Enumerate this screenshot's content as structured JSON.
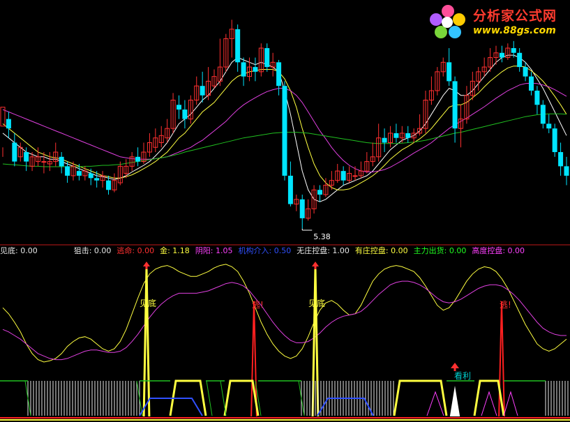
{
  "logo": {
    "title": "分析家公式网",
    "url": "www.88gs.com"
  },
  "legend": [
    {
      "label": "见底:",
      "value": "0.00",
      "color": "#e6e6e6"
    },
    {
      "label": "狙击:",
      "value": "0.00",
      "color": "#e6e6e6"
    },
    {
      "label": "逃命:",
      "value": "0.00",
      "color": "#ff3030"
    },
    {
      "label": "金:",
      "value": "1.18",
      "color": "#ffff40"
    },
    {
      "label": "阴阳:",
      "value": "1.05",
      "color": "#ff40ff"
    },
    {
      "label": "机构介入:",
      "value": "0.50",
      "color": "#3050ff"
    },
    {
      "label": "无庄控盘:",
      "value": "1.00",
      "color": "#e6e6e6"
    },
    {
      "label": "有庄控盘:",
      "value": "0.00",
      "color": "#ffff40"
    },
    {
      "label": "主力出货:",
      "value": "0.00",
      "color": "#20ff20"
    },
    {
      "label": "高度控盘:",
      "value": "0.00",
      "color": "#ff40ff"
    }
  ],
  "chart_data": [
    {
      "type": "candlestick",
      "price_label": "5.38",
      "colors": {
        "up": "#ff3030",
        "down": "#00e5ff",
        "ma_white": "#ffffff",
        "ma_yellow": "#ffff40",
        "ma_magenta": "#e040e0",
        "ma_green": "#20c020"
      },
      "candles": [
        [
          7.55,
          7.95,
          7.1,
          6.9
        ],
        [
          7.7,
          7.5,
          7.85,
          7.3
        ],
        [
          7.2,
          6.8,
          7.4,
          6.7
        ],
        [
          6.9,
          7.1,
          7.2,
          6.8
        ],
        [
          7.0,
          6.8,
          7.1,
          6.6
        ],
        [
          6.7,
          6.9,
          7.0,
          6.6
        ],
        [
          6.8,
          6.9,
          7.1,
          6.7
        ],
        [
          6.8,
          6.8,
          7.0,
          6.55
        ],
        [
          6.75,
          6.8,
          7.0,
          6.6
        ],
        [
          6.8,
          7.0,
          7.2,
          6.7
        ],
        [
          6.9,
          6.7,
          7.0,
          6.55
        ],
        [
          6.7,
          6.5,
          6.8,
          6.35
        ],
        [
          6.5,
          6.7,
          6.8,
          6.4
        ],
        [
          6.6,
          6.5,
          6.75,
          6.4
        ],
        [
          6.5,
          6.6,
          6.7,
          6.4
        ],
        [
          6.55,
          6.45,
          6.65,
          6.3
        ],
        [
          6.45,
          6.4,
          6.6,
          6.25
        ],
        [
          6.4,
          6.5,
          6.6,
          6.25
        ],
        [
          6.4,
          6.2,
          6.5,
          6.1
        ],
        [
          6.2,
          6.4,
          6.55,
          6.15
        ],
        [
          6.35,
          6.7,
          6.8,
          6.3
        ],
        [
          6.55,
          6.7,
          6.85,
          6.45
        ],
        [
          6.7,
          6.9,
          7.0,
          6.6
        ],
        [
          6.9,
          6.8,
          7.1,
          6.7
        ],
        [
          6.8,
          7.0,
          7.2,
          6.75
        ],
        [
          7.0,
          7.2,
          7.4,
          6.9
        ],
        [
          7.1,
          7.3,
          7.5,
          7.0
        ],
        [
          7.2,
          7.35,
          7.55,
          7.1
        ],
        [
          7.3,
          7.5,
          7.7,
          7.2
        ],
        [
          7.5,
          8.1,
          8.25,
          7.4
        ],
        [
          8.0,
          7.9,
          8.2,
          7.7
        ],
        [
          7.9,
          7.7,
          8.1,
          7.5
        ],
        [
          7.7,
          8.1,
          8.2,
          7.6
        ],
        [
          8.1,
          8.4,
          8.6,
          8.0
        ],
        [
          8.4,
          8.2,
          8.7,
          8.05
        ],
        [
          8.2,
          8.5,
          8.8,
          8.1
        ],
        [
          8.4,
          8.6,
          8.75,
          8.35
        ],
        [
          8.5,
          8.8,
          9.4,
          8.4
        ],
        [
          8.8,
          9.4,
          9.5,
          8.7
        ],
        [
          9.4,
          9.6,
          9.8,
          9.0
        ],
        [
          9.6,
          8.9,
          9.7,
          8.7
        ],
        [
          8.9,
          8.6,
          9.0,
          8.4
        ],
        [
          8.6,
          8.8,
          9.0,
          8.5
        ],
        [
          8.8,
          8.7,
          9.0,
          8.5
        ],
        [
          8.7,
          9.2,
          9.3,
          8.6
        ],
        [
          9.2,
          8.8,
          9.3,
          8.7
        ],
        [
          8.8,
          8.9,
          9.1,
          8.6
        ],
        [
          8.9,
          8.4,
          8.95,
          8.2
        ],
        [
          8.4,
          6.5,
          8.5,
          6.4
        ],
        [
          6.5,
          5.9,
          6.8,
          5.85
        ],
        [
          5.9,
          6.0,
          6.1,
          5.75
        ],
        [
          6.0,
          5.6,
          6.1,
          5.38
        ],
        [
          5.6,
          5.8,
          6.0,
          5.55
        ],
        [
          5.8,
          6.2,
          6.3,
          5.7
        ],
        [
          6.2,
          6.1,
          6.3,
          5.95
        ],
        [
          6.1,
          6.3,
          6.45,
          6.05
        ],
        [
          6.3,
          6.4,
          6.6,
          6.2
        ],
        [
          6.4,
          6.6,
          6.75,
          6.35
        ],
        [
          6.6,
          6.4,
          6.7,
          6.3
        ],
        [
          6.4,
          6.55,
          6.7,
          6.35
        ],
        [
          6.5,
          6.5,
          6.7,
          6.4
        ],
        [
          6.5,
          6.6,
          6.8,
          6.45
        ],
        [
          6.6,
          6.8,
          7.0,
          6.55
        ],
        [
          6.8,
          6.9,
          7.2,
          6.7
        ],
        [
          6.9,
          7.3,
          7.6,
          6.8
        ],
        [
          7.3,
          7.2,
          7.5,
          7.0
        ],
        [
          7.2,
          7.4,
          7.55,
          7.1
        ],
        [
          7.4,
          7.3,
          7.6,
          7.2
        ],
        [
          7.3,
          7.4,
          7.55,
          7.2
        ],
        [
          7.4,
          7.3,
          7.55,
          7.2
        ],
        [
          7.3,
          7.4,
          7.5,
          7.2
        ],
        [
          7.4,
          7.5,
          7.8,
          7.35
        ],
        [
          7.5,
          8.1,
          8.3,
          7.4
        ],
        [
          8.1,
          8.3,
          8.6,
          8.0
        ],
        [
          8.3,
          8.7,
          8.8,
          8.2
        ],
        [
          8.7,
          8.9,
          9.0,
          8.6
        ],
        [
          8.9,
          8.5,
          9.2,
          8.4
        ],
        [
          8.5,
          7.5,
          8.6,
          7.2
        ],
        [
          7.5,
          7.7,
          8.0,
          7.1
        ],
        [
          7.7,
          8.2,
          8.4,
          7.6
        ],
        [
          8.2,
          8.5,
          8.7,
          8.1
        ],
        [
          8.5,
          8.7,
          8.8,
          8.3
        ],
        [
          8.7,
          8.8,
          9.0,
          8.6
        ],
        [
          8.8,
          9.0,
          9.2,
          8.7
        ],
        [
          9.0,
          9.1,
          9.25,
          8.85
        ],
        [
          9.1,
          9.0,
          9.25,
          8.9
        ],
        [
          9.0,
          9.2,
          9.3,
          8.95
        ],
        [
          9.2,
          9.1,
          9.35,
          9.0
        ],
        [
          9.1,
          8.8,
          9.2,
          8.7
        ],
        [
          8.8,
          8.6,
          8.9,
          8.5
        ],
        [
          8.6,
          8.3,
          8.7,
          8.2
        ],
        [
          8.3,
          8.0,
          8.4,
          7.8
        ],
        [
          8.0,
          7.6,
          8.1,
          7.5
        ],
        [
          7.6,
          7.5,
          7.8,
          7.4
        ],
        [
          7.5,
          7.0,
          7.6,
          6.9
        ],
        [
          7.0,
          6.7,
          7.2,
          6.5
        ],
        [
          6.7,
          6.5,
          6.9,
          6.3
        ]
      ],
      "ma_series": [
        {
          "color": "#ffffff",
          "values": [
            7.4,
            7.3,
            7.2,
            7.1,
            7.0,
            6.95,
            6.9,
            6.9,
            6.85,
            6.85,
            6.8,
            6.75,
            6.7,
            6.65,
            6.6,
            6.55,
            6.5,
            6.48,
            6.45,
            6.42,
            6.45,
            6.5,
            6.58,
            6.65,
            6.72,
            6.8,
            6.92,
            7.05,
            7.2,
            7.4,
            7.6,
            7.7,
            7.8,
            7.95,
            8.1,
            8.2,
            8.35,
            8.5,
            8.7,
            8.9,
            9.0,
            8.95,
            8.9,
            8.85,
            8.9,
            8.85,
            8.8,
            8.7,
            8.3,
            7.8,
            7.2,
            6.6,
            6.2,
            6.0,
            5.95,
            6.0,
            6.1,
            6.2,
            6.3,
            6.35,
            6.4,
            6.45,
            6.5,
            6.6,
            6.75,
            6.9,
            7.05,
            7.15,
            7.25,
            7.3,
            7.35,
            7.45,
            7.6,
            7.8,
            8.0,
            8.2,
            8.35,
            8.3,
            8.2,
            8.2,
            8.3,
            8.45,
            8.6,
            8.75,
            8.9,
            9.0,
            9.05,
            9.05,
            9.0,
            8.9,
            8.75,
            8.55,
            8.35,
            8.1,
            7.85,
            7.6,
            7.35
          ]
        },
        {
          "color": "#ffff40",
          "values": [
            7.6,
            7.5,
            7.4,
            7.3,
            7.2,
            7.1,
            7.0,
            6.95,
            6.9,
            6.88,
            6.85,
            6.8,
            6.75,
            6.7,
            6.65,
            6.6,
            6.55,
            6.5,
            6.48,
            6.45,
            6.45,
            6.48,
            6.52,
            6.58,
            6.65,
            6.72,
            6.8,
            6.9,
            7.0,
            7.15,
            7.3,
            7.4,
            7.55,
            7.7,
            7.85,
            7.95,
            8.05,
            8.2,
            8.35,
            8.5,
            8.6,
            8.65,
            8.7,
            8.72,
            8.75,
            8.75,
            8.75,
            8.7,
            8.55,
            8.3,
            7.95,
            7.5,
            7.1,
            6.75,
            6.5,
            6.35,
            6.25,
            6.2,
            6.2,
            6.22,
            6.28,
            6.35,
            6.42,
            6.5,
            6.6,
            6.72,
            6.85,
            6.95,
            7.05,
            7.12,
            7.2,
            7.28,
            7.38,
            7.5,
            7.65,
            7.8,
            7.95,
            8.0,
            8.0,
            8.05,
            8.15,
            8.25,
            8.38,
            8.5,
            8.6,
            8.7,
            8.78,
            8.82,
            8.82,
            8.8,
            8.72,
            8.62,
            8.5,
            8.35,
            8.18,
            8.0,
            7.8
          ]
        },
        {
          "color": "#e040e0",
          "values": [
            7.9,
            7.85,
            7.8,
            7.75,
            7.7,
            7.65,
            7.6,
            7.55,
            7.5,
            7.45,
            7.4,
            7.35,
            7.3,
            7.25,
            7.2,
            7.15,
            7.1,
            7.05,
            7.0,
            6.95,
            6.9,
            6.88,
            6.86,
            6.85,
            6.85,
            6.85,
            6.86,
            6.88,
            6.9,
            6.95,
            7.0,
            7.05,
            7.1,
            7.18,
            7.25,
            7.35,
            7.45,
            7.55,
            7.65,
            7.78,
            7.9,
            8.0,
            8.08,
            8.15,
            8.22,
            8.28,
            8.32,
            8.35,
            8.35,
            8.3,
            8.2,
            8.05,
            7.85,
            7.65,
            7.45,
            7.28,
            7.1,
            6.95,
            6.82,
            6.72,
            6.65,
            6.6,
            6.58,
            6.58,
            6.6,
            6.63,
            6.68,
            6.75,
            6.82,
            6.9,
            6.98,
            7.05,
            7.12,
            7.2,
            7.3,
            7.4,
            7.5,
            7.58,
            7.65,
            7.72,
            7.8,
            7.88,
            7.96,
            8.05,
            8.14,
            8.22,
            8.3,
            8.36,
            8.42,
            8.45,
            8.46,
            8.45,
            8.42,
            8.38,
            8.32,
            8.25,
            8.18
          ]
        },
        {
          "color": "#20c020",
          "values": [
            6.75,
            6.74,
            6.73,
            6.72,
            6.71,
            6.7,
            6.7,
            6.69,
            6.69,
            6.69,
            6.69,
            6.69,
            6.69,
            6.69,
            6.7,
            6.7,
            6.71,
            6.72,
            6.72,
            6.73,
            6.74,
            6.76,
            6.78,
            6.8,
            6.82,
            6.84,
            6.86,
            6.88,
            6.9,
            6.93,
            6.96,
            7.0,
            7.03,
            7.06,
            7.09,
            7.12,
            7.15,
            7.18,
            7.21,
            7.24,
            7.27,
            7.3,
            7.32,
            7.34,
            7.36,
            7.38,
            7.4,
            7.41,
            7.42,
            7.42,
            7.42,
            7.41,
            7.4,
            7.38,
            7.36,
            7.34,
            7.32,
            7.3,
            7.28,
            7.26,
            7.24,
            7.22,
            7.2,
            7.19,
            7.18,
            7.18,
            7.18,
            7.18,
            7.19,
            7.2,
            7.21,
            7.23,
            7.25,
            7.28,
            7.31,
            7.34,
            7.37,
            7.4,
            7.42,
            7.45,
            7.48,
            7.51,
            7.54,
            7.57,
            7.6,
            7.63,
            7.66,
            7.69,
            7.72,
            7.75,
            7.77,
            7.79,
            7.8,
            7.81,
            7.81,
            7.81,
            7.8
          ]
        }
      ]
    },
    {
      "type": "line",
      "annotations": [
        "见底",
        "逃!",
        "见底",
        "逃!",
        "看利"
      ],
      "series": [
        {
          "color": "#ffff40",
          "values": [
            60,
            55,
            48,
            40,
            30,
            22,
            17,
            15,
            16,
            18,
            22,
            28,
            32,
            35,
            36,
            34,
            30,
            26,
            24,
            26,
            32,
            42,
            55,
            68,
            80,
            88,
            92,
            94,
            95,
            93,
            90,
            88,
            86,
            86,
            88,
            90,
            93,
            95,
            96,
            94,
            90,
            82,
            72,
            60,
            48,
            38,
            30,
            24,
            20,
            18,
            20,
            26,
            36,
            48,
            58,
            64,
            66,
            63,
            58,
            54,
            55,
            62,
            72,
            82,
            88,
            92,
            94,
            95,
            94,
            92,
            90,
            85,
            78,
            70,
            62,
            58,
            60,
            66,
            74,
            82,
            88,
            92,
            94,
            93,
            90,
            84,
            76,
            66,
            56,
            46,
            38,
            30,
            26,
            24,
            26,
            30,
            34
          ]
        },
        {
          "color": "#e040e0",
          "values": [
            42,
            40,
            37,
            34,
            30,
            26,
            22,
            20,
            18,
            17,
            17,
            18,
            20,
            22,
            24,
            25,
            25,
            24,
            23,
            23,
            24,
            27,
            32,
            38,
            45,
            52,
            58,
            63,
            67,
            70,
            72,
            72,
            72,
            72,
            73,
            74,
            76,
            78,
            80,
            81,
            80,
            78,
            74,
            68,
            62,
            55,
            48,
            42,
            37,
            33,
            31,
            31,
            32,
            35,
            39,
            44,
            48,
            51,
            53,
            54,
            55,
            57,
            61,
            66,
            71,
            75,
            79,
            81,
            82,
            82,
            81,
            79,
            76,
            72,
            68,
            65,
            64,
            65,
            67,
            70,
            73,
            76,
            78,
            79,
            79,
            78,
            75,
            71,
            66,
            60,
            54,
            48,
            43,
            40,
            38,
            37,
            37
          ]
        }
      ]
    }
  ]
}
